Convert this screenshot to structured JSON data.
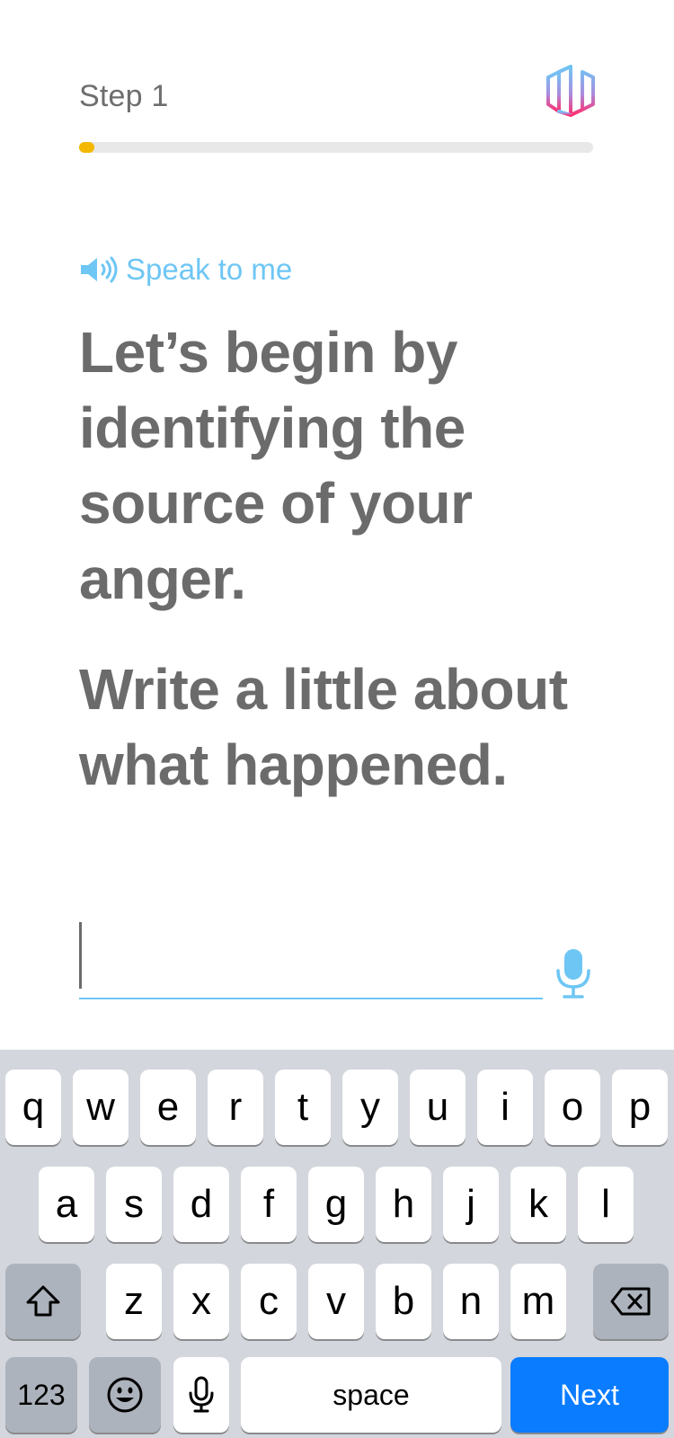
{
  "header": {
    "step_label": "Step 1",
    "progress": 0.03,
    "logo_icon": "brand-logo-icon"
  },
  "speak": {
    "icon": "speaker-icon",
    "label": "Speak to me"
  },
  "prompt": {
    "line1": "Let’s begin by identifying the source of your anger.",
    "line2": "Write a little about what happened."
  },
  "input": {
    "value": "",
    "placeholder": "",
    "mic_icon": "microphone-icon"
  },
  "keyboard": {
    "row1": [
      "q",
      "w",
      "e",
      "r",
      "t",
      "y",
      "u",
      "i",
      "o",
      "p"
    ],
    "row2": [
      "a",
      "s",
      "d",
      "f",
      "g",
      "h",
      "j",
      "k",
      "l"
    ],
    "row3": [
      "z",
      "x",
      "c",
      "v",
      "b",
      "n",
      "m"
    ],
    "numbers_label": "123",
    "space_label": "space",
    "next_label": "Next",
    "shift_icon": "shift-icon",
    "backspace_icon": "backspace-icon",
    "emoji_icon": "emoji-icon",
    "dictation_icon": "microphone-icon"
  },
  "colors": {
    "accent": "#6ec6f4",
    "progress": "#f5b800",
    "text": "#6b6b6b",
    "next_key": "#0a7cff",
    "keyboard_bg": "#d3d6dc"
  }
}
